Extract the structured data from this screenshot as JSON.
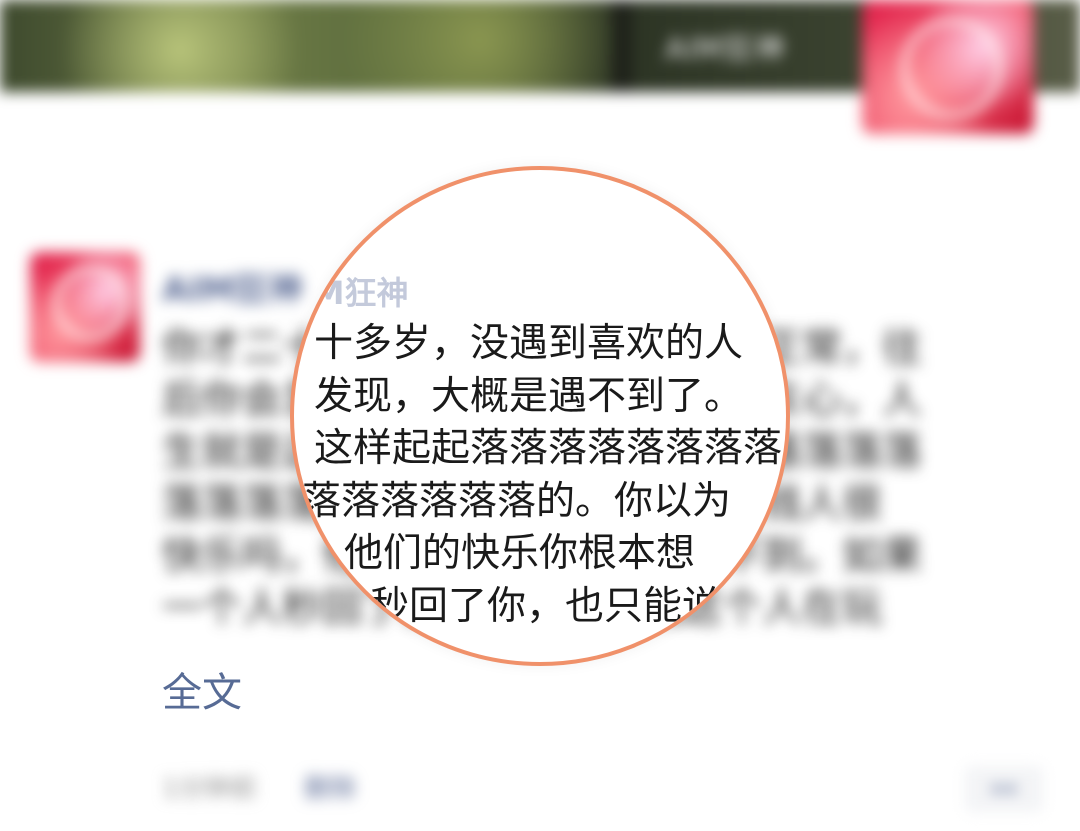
{
  "cover": {
    "user_name": "AIM狂神"
  },
  "post": {
    "author": "AIM狂神",
    "lines_full": [
      "你才二十多岁，没遇到喜欢的人很正常，往",
      "后你会发现，大概是遇不到了。别灰心，人",
      "生就是这样起起落落落落落落落落落落落落",
      "落落落落落落落落落的。你以为有钱人很",
      "快乐吗，他们的快乐你根本想象不到。如果",
      "一个人秒回了你，也只能说明这个人在玩"
    ],
    "magnified_lines": [
      "十多岁，没遇到喜欢的人",
      "发现，大概是遇不到了。",
      "这样起起落落落落落落落落",
      "落落落落落落的。你以为",
      "他们的快乐你根本想",
      "个人秒回了你，也只能说"
    ],
    "full_text_label": "全文",
    "time": "1分钟前",
    "delete_label": "删除"
  },
  "colors": {
    "link": "#576b95",
    "magnifier_border": "#f0916a",
    "logo_red": "#e0204a"
  },
  "icons": {
    "more": "more-dots-icon"
  }
}
